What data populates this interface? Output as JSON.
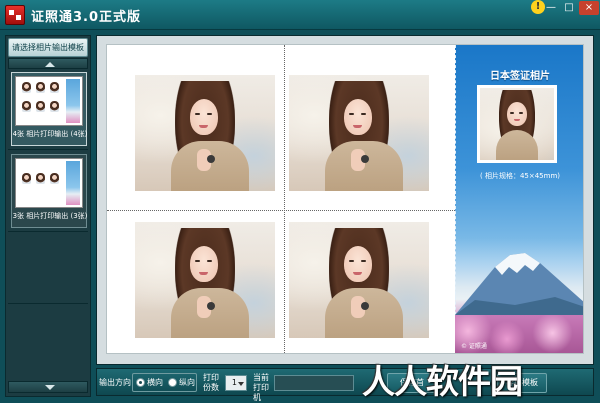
{
  "window": {
    "title": "证照通3.0正式版",
    "help_glyph": "!",
    "min_glyph": "—",
    "max_glyph": "□",
    "close_glyph": "×"
  },
  "sidebar": {
    "header": "请选择相片输出模板",
    "templates": [
      {
        "label": "4张 相片打印输出 (4张)",
        "selected": true
      },
      {
        "label": "3张 相片打印输出 (3张)",
        "selected": false
      }
    ]
  },
  "canvas": {
    "panel_title": "日本签证相片",
    "panel_spec": "( 相片规格：45×45mm)",
    "panel_copyright": "© 证照通",
    "photo_count": 4
  },
  "toolbar": {
    "orientation_label": "输出方向",
    "orientation_options": [
      "横向",
      "纵向"
    ],
    "orientation_selected": "横向",
    "copies_label": "打印份数",
    "copies_value": "1",
    "printer_label": "当前打印机",
    "printer_value": "",
    "save_first_label": "保存首",
    "export_template_label": "导出模板"
  },
  "watermark": {
    "text": "人人软件园"
  }
}
